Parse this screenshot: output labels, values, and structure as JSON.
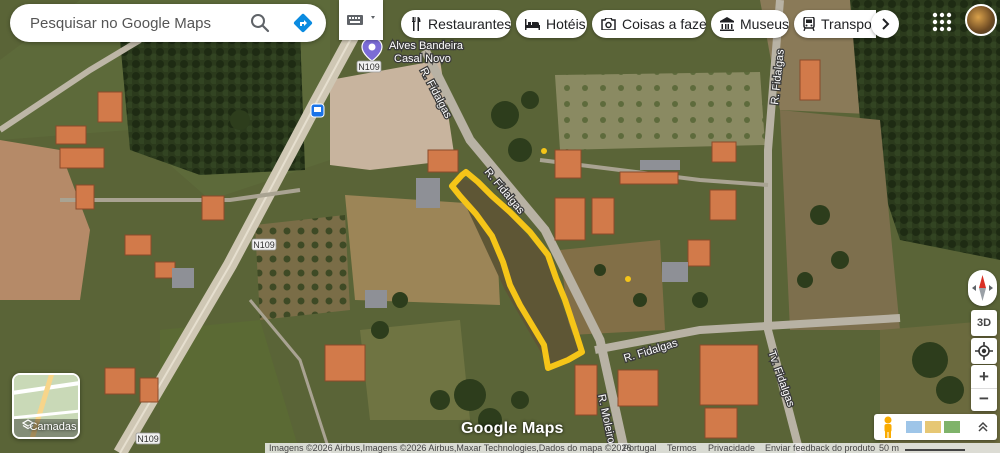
{
  "search": {
    "placeholder": "Pesquisar no Google Maps"
  },
  "chips": [
    {
      "label": "Restaurantes",
      "icon": "fork-knife-icon"
    },
    {
      "label": "Hotéis",
      "icon": "bed-icon"
    },
    {
      "label": "Coisas a fazer",
      "icon": "camera-icon"
    },
    {
      "label": "Museus",
      "icon": "museum-icon"
    },
    {
      "label": "Transport",
      "icon": "transit-icon"
    }
  ],
  "map": {
    "labels": {
      "place_line1": "Alves Bandeira",
      "place_line2": "Casal Novo",
      "road_n109": "N109",
      "street_fidalgas": "R. Fidalgas",
      "street_moleiro": "R. Moleiro",
      "street_tv_fidalgas": "Tv. Fidalgas"
    }
  },
  "controls": {
    "layers_label": "Camadas",
    "three_d_label": "3D",
    "zoom_in": "+",
    "zoom_out": "−"
  },
  "watermark": "Google Maps",
  "footer": {
    "imagery": "Imagens ©2026 Airbus,Imagens ©2026 Airbus,Maxar Technologies,Dados do mapa ©2026",
    "country": "Portugal",
    "terms": "Termos",
    "privacy": "Privacidade",
    "feedback": "Enviar feedback do produto",
    "scale": "50 m"
  },
  "colors": {
    "highlight_outline": "#f5c518",
    "search_accent": "#1a73e8"
  }
}
